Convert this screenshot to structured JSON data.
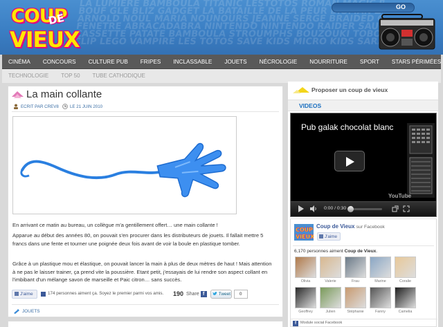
{
  "site": {
    "logo_line1": "COUP",
    "logo_line2": "DE",
    "logo_line3": "VIEUX",
    "search_button": "GO",
    "header_bg_words": [
      "LA LUMIERE BAMBOULA TITANIC LESTOTOS ROMAN MAGIC ROBOT",
      "BOUF GLE BLIZ GADGET LA BATAILLE DE LA PEUR BIOMAN ZORRO",
      "ARNOLD NOUL MARIA NOUNOURS JEANNE SERGE BRAIDED GOLDORAK",
      "FENETRE ABRACADABRA NINTENDO NINTENDO RAIDER SAUVETAGE",
      "CASSETTE PATATE BAMBOULA STROUMPHS BOUZOUKI TOBOGGAN",
      "CLIP LEGO VAMPIRE LES TOTOS SAVE KIDS MICRO KIDS SARAH"
    ]
  },
  "nav": {
    "primary": [
      "CINÉMA",
      "CONCOURS",
      "CULTURE PUB",
      "FRIPES",
      "INCLASSABLE",
      "JOUETS",
      "NÉCROLOGIE",
      "NOURRITURE",
      "SPORT",
      "STARS PÉRIMÉES"
    ],
    "secondary": [
      "TECHNOLOGIE",
      "TOP 50",
      "TUBE CATHODIQUE"
    ]
  },
  "article": {
    "title": "La main collante",
    "author_prefix": "ECRIT PAR",
    "author": "CREV8",
    "date": "LE 21 JUIN 2010",
    "paragraphs": [
      "En arrivant ce matin au bureau, un collègue m'a gentillement offert… une main collante !",
      "Apparue au début des années 80, on pouvait s'en procurer dans les distributeurs de jouets. Il fallait mettre 5 francs dans une fente et tourner une poignée deux fois avant de voir la boule en plastique tomber.",
      "Grâce à un plastique mou et élastique, on pouvait lancer la main à plus de deux mètres de haut ! Mais attention à ne pas le laisser trainer, ça prend vite la poussière. Etant petit, j'essayais de lui rendre son aspect collant en l'imbibant d'un mélange savon de marseille et Paic citron… sans succès."
    ],
    "fb_like_label": "J'aime",
    "fb_like_count_text": "174 personnes aiment ça. Soyez le premier parmi vos amis.",
    "share_count": "190",
    "share_label": "Share",
    "tweet_label": "Tweet",
    "tweet_count": "0",
    "category": "JOUETS"
  },
  "sidebar": {
    "propose_label": "Proposer un coup de vieux",
    "videos_heading": "VIDEOS",
    "video": {
      "title": "Pub galak chocolat blanc",
      "time": "0:00 / 0:30",
      "brand": "YouTube",
      "progress": 0
    },
    "facebook": {
      "page_name": "Coup de Vieux",
      "on_facebook": "sur Facebook",
      "like_label": "J'aime",
      "fans_count_text": "6,170 personnes aiment",
      "fans_page_bold": "Coup de Vieux",
      "fans_suffix": ".",
      "fans": [
        {
          "name": "Olivia",
          "color": "#b07a4a"
        },
        {
          "name": "Valerie",
          "color": "#d8b890"
        },
        {
          "name": "Frau",
          "color": "#6a7a88"
        },
        {
          "name": "Marine",
          "color": "#8aa6c4"
        },
        {
          "name": "Coralie",
          "color": "#e8c898"
        },
        {
          "name": "Geoffrey",
          "color": "#2a2a2a"
        },
        {
          "name": "Julien",
          "color": "#7a9a5a"
        },
        {
          "name": "Stéphanie",
          "color": "#c89a70"
        },
        {
          "name": "Fanny",
          "color": "#555555"
        },
        {
          "name": "Camelia",
          "color": "#1e1e1e"
        }
      ],
      "module_label": "Module social Facebook"
    }
  },
  "colors": {
    "header_blue": "#3b7fc4",
    "nav_dark": "#595959",
    "logo_yellow": "#ffe600",
    "logo_magenta": "#e5007e",
    "link_blue": "#3a6ea5",
    "facebook_blue": "#3b5998"
  }
}
